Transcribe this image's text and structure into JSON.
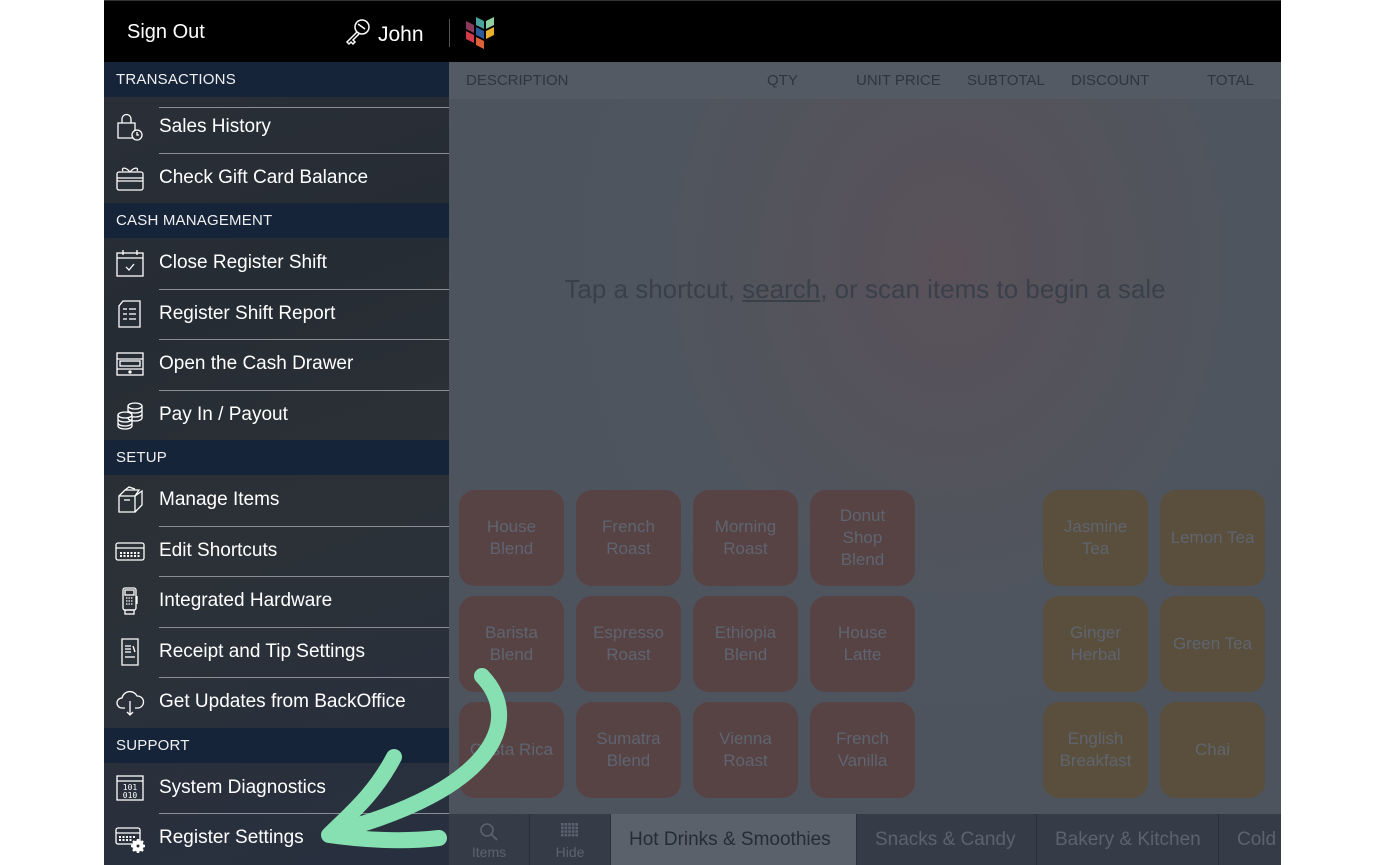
{
  "topbar": {
    "sign_out": "Sign Out",
    "user_name": "John",
    "user_icon": "key-icon",
    "logo": "app-logo"
  },
  "sidebar": {
    "sections": [
      {
        "header": "TRANSACTIONS",
        "items": [
          {
            "label": "Sales History",
            "icon": "shopping-bag-clock-icon"
          },
          {
            "label": "Check Gift Card Balance",
            "icon": "gift-card-icon"
          }
        ]
      },
      {
        "header": "CASH MANAGEMENT",
        "items": [
          {
            "label": "Close Register Shift",
            "icon": "calendar-check-icon"
          },
          {
            "label": "Register Shift Report",
            "icon": "report-icon"
          },
          {
            "label": "Open the Cash Drawer",
            "icon": "cash-drawer-icon"
          },
          {
            "label": "Pay In / Payout",
            "icon": "coins-icon"
          }
        ]
      },
      {
        "header": "SETUP",
        "items": [
          {
            "label": "Manage Items",
            "icon": "box-icon"
          },
          {
            "label": "Edit Shortcuts",
            "icon": "keyboard-icon"
          },
          {
            "label": "Integrated Hardware",
            "icon": "card-terminal-icon"
          },
          {
            "label": "Receipt and Tip Settings",
            "icon": "receipt-icon"
          },
          {
            "label": "Get Updates from BackOffice",
            "icon": "cloud-download-icon"
          }
        ]
      },
      {
        "header": "SUPPORT",
        "items": [
          {
            "label": "System Diagnostics",
            "icon": "binary-icon"
          },
          {
            "label": "Register Settings",
            "icon": "register-gear-icon"
          }
        ]
      }
    ]
  },
  "cart": {
    "columns": [
      "DESCRIPTION",
      "QTY",
      "UNIT PRICE",
      "SUBTOTAL",
      "DISCOUNT",
      "TOTAL"
    ],
    "empty_message": {
      "before": "Tap a shortcut, ",
      "link": "search",
      "after": ", or scan items to begin a sale"
    }
  },
  "shortcuts": {
    "coffee": [
      [
        "House\nBlend",
        "French\nRoast",
        "Morning\nRoast",
        "Donut\nShop\nBlend"
      ],
      [
        "Barista\nBlend",
        "Espresso\nRoast",
        "Ethiopia\nBlend",
        "House\nLatte"
      ],
      [
        "Costa Rica",
        "Sumatra\nBlend",
        "Vienna\nRoast",
        "French\nVanilla"
      ]
    ],
    "tea": [
      [
        "Jasmine\nTea",
        "Lemon Tea"
      ],
      [
        "Ginger\nHerbal",
        "Green Tea"
      ],
      [
        "English\nBreakfast",
        "Chai"
      ]
    ],
    "colors": {
      "coffee": "#574244",
      "tea": "#5a4e3c"
    }
  },
  "tabbar": {
    "tools": [
      {
        "label": "Items",
        "icon": "search-icon"
      },
      {
        "label": "Hide",
        "icon": "grid-icon"
      }
    ],
    "categories": [
      {
        "label": "Hot Drinks & Smoothies",
        "active": true
      },
      {
        "label": "Snacks & Candy",
        "active": false
      },
      {
        "label": "Bakery & Kitchen",
        "active": false
      },
      {
        "label": "Cold Drinks",
        "active": false
      }
    ]
  },
  "annotation": {
    "type": "arrow",
    "color": "#86e0b1",
    "target": "Register Settings"
  }
}
